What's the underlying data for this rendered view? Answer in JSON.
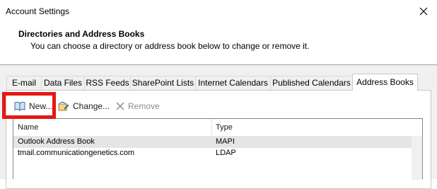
{
  "window": {
    "title": "Account Settings"
  },
  "header": {
    "title": "Directories and Address Books",
    "subtitle": "You can choose a directory or address book below to change or remove it."
  },
  "tabs": [
    {
      "label": "E-mail",
      "active": false
    },
    {
      "label": "Data Files",
      "active": false
    },
    {
      "label": "RSS Feeds",
      "active": false
    },
    {
      "label": "SharePoint Lists",
      "active": false
    },
    {
      "label": "Internet Calendars",
      "active": false
    },
    {
      "label": "Published Calendars",
      "active": false
    },
    {
      "label": "Address Books",
      "active": true
    }
  ],
  "toolbar": {
    "new_label": "New...",
    "change_label": "Change...",
    "remove_label": "Remove"
  },
  "list": {
    "columns": [
      "Name",
      "Type"
    ],
    "rows": [
      {
        "name": "Outlook Address Book",
        "type": "MAPI",
        "selected": true
      },
      {
        "name": "tmail.communicationgenetics.com",
        "type": "LDAP",
        "selected": false
      }
    ]
  },
  "colors": {
    "highlight": "#e81616",
    "selected_row": "#e5e5e5",
    "dialog_bg": "#f0f0f0"
  },
  "icons": [
    "close-icon",
    "address-book-icon",
    "change-icon",
    "remove-x-icon"
  ]
}
